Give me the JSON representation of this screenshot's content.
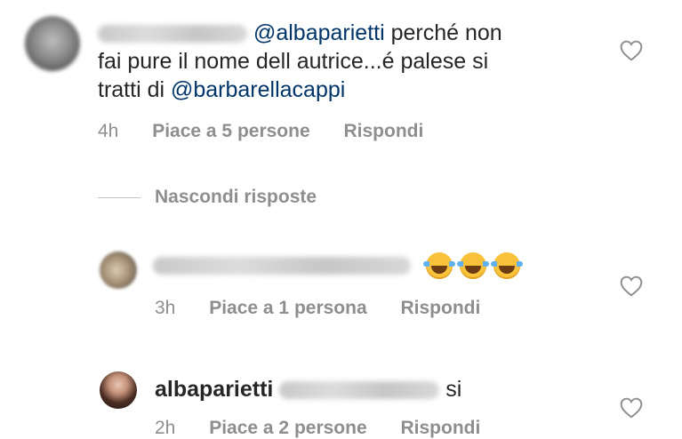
{
  "comments": [
    {
      "mention": "@albaparietti",
      "text_1": " perché non",
      "line_2": "fai pure il nome dell autrice...é palese si",
      "line_3_prefix": "tratti di ",
      "mention_2": "@barbarellacappi",
      "time": "4h",
      "likes": "Piace a 5 persone",
      "reply": "Rispondi"
    },
    {
      "time": "3h",
      "likes": "Piace a 1 persona",
      "reply": "Rispondi",
      "emoji_icons": [
        "laughing-tears-icon",
        "laughing-tears-icon",
        "laughing-tears-icon"
      ]
    },
    {
      "username": "albaparietti",
      "text": "si",
      "time": "2h",
      "likes": "Piace a 2 persone",
      "reply": "Rispondi"
    }
  ],
  "thread": {
    "hide_replies": "Nascondi risposte"
  },
  "colors": {
    "mention": "#003569",
    "meta_gray": "#8e8e8e",
    "text": "#262626"
  }
}
